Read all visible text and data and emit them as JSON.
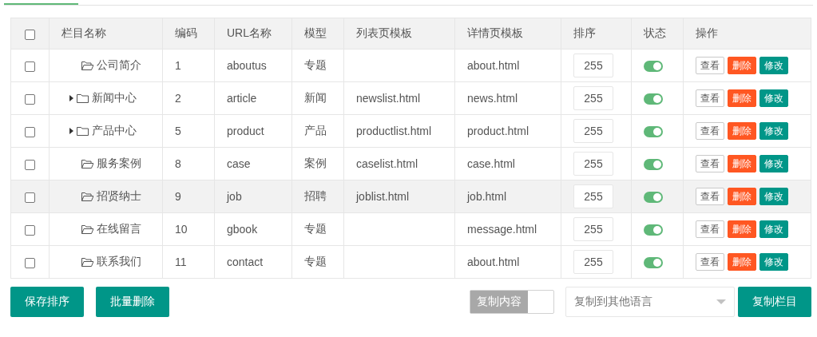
{
  "table": {
    "columns": [
      "栏目名称",
      "编码",
      "URL名称",
      "模型",
      "列表页模板",
      "详情页模板",
      "排序",
      "状态",
      "操作"
    ],
    "header_checkbox": {
      "checked": false
    },
    "rows": [
      {
        "checked": false,
        "expandable": false,
        "name": "公司简介",
        "code": "1",
        "url": "aboutus",
        "model": "专题",
        "list_template": "",
        "detail_template": "about.html",
        "sort": "255",
        "on": true,
        "highlighted": false,
        "actions": [
          "查看",
          "删除",
          "修改"
        ]
      },
      {
        "checked": false,
        "expandable": true,
        "name": "新闻中心",
        "code": "2",
        "url": "article",
        "model": "新闻",
        "list_template": "newslist.html",
        "detail_template": "news.html",
        "sort": "255",
        "on": true,
        "highlighted": false,
        "actions": [
          "查看",
          "删除",
          "修改"
        ]
      },
      {
        "checked": false,
        "expandable": true,
        "name": "产品中心",
        "code": "5",
        "url": "product",
        "model": "产品",
        "list_template": "productlist.html",
        "detail_template": "product.html",
        "sort": "255",
        "on": true,
        "highlighted": false,
        "actions": [
          "查看",
          "删除",
          "修改"
        ]
      },
      {
        "checked": false,
        "expandable": false,
        "name": "服务案例",
        "code": "8",
        "url": "case",
        "model": "案例",
        "list_template": "caselist.html",
        "detail_template": "case.html",
        "sort": "255",
        "on": true,
        "highlighted": false,
        "actions": [
          "查看",
          "删除",
          "修改"
        ]
      },
      {
        "checked": false,
        "expandable": false,
        "name": "招贤纳士",
        "code": "9",
        "url": "job",
        "model": "招聘",
        "list_template": "joblist.html",
        "detail_template": "job.html",
        "sort": "255",
        "on": true,
        "highlighted": true,
        "actions": [
          "查看",
          "删除",
          "修改"
        ]
      },
      {
        "checked": false,
        "expandable": false,
        "name": "在线留言",
        "code": "10",
        "url": "gbook",
        "model": "专题",
        "list_template": "",
        "detail_template": "message.html",
        "sort": "255",
        "on": true,
        "highlighted": false,
        "actions": [
          "查看",
          "删除",
          "修改"
        ]
      },
      {
        "checked": false,
        "expandable": false,
        "name": "联系我们",
        "code": "11",
        "url": "contact",
        "model": "专题",
        "list_template": "",
        "detail_template": "about.html",
        "sort": "255",
        "on": true,
        "highlighted": false,
        "actions": [
          "查看",
          "删除",
          "修改"
        ]
      }
    ]
  },
  "footer": {
    "buttons": [
      "保存排序",
      "批量删除"
    ],
    "copy_content": {
      "label": "复制内容",
      "on": false
    },
    "language_select": {
      "placeholder": "复制到其他语言"
    },
    "copy_button": "复制栏目"
  }
}
